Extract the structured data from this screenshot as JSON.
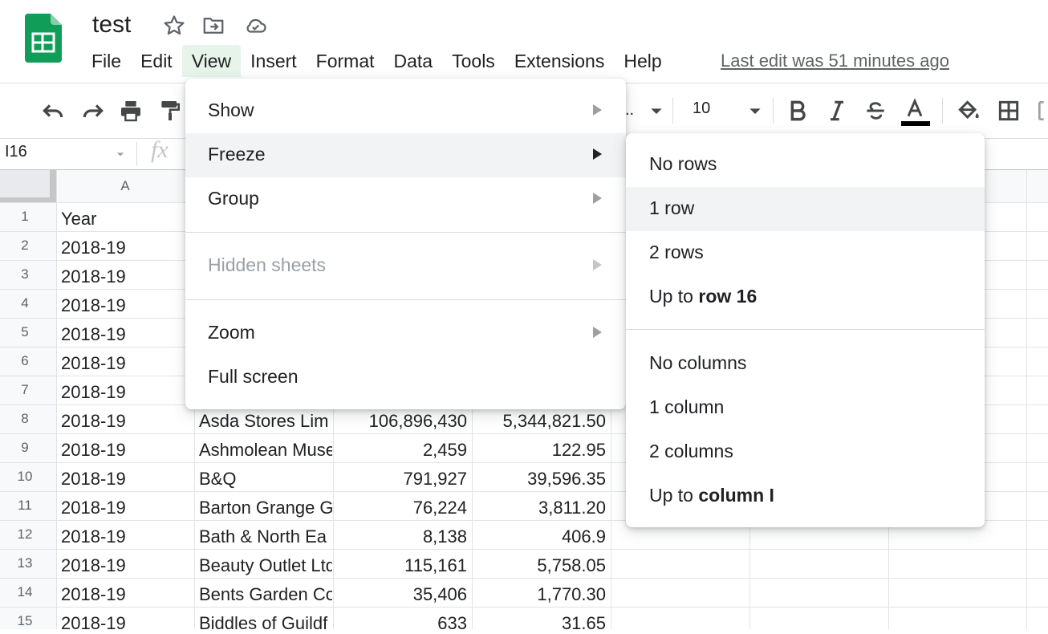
{
  "app": {
    "doc_title": "test",
    "last_edit": "Last edit was 51 minutes ago"
  },
  "menubar": {
    "items": [
      "File",
      "Edit",
      "View",
      "Insert",
      "Format",
      "Data",
      "Tools",
      "Extensions",
      "Help"
    ],
    "active": "View"
  },
  "toolbar": {
    "font_size": "10",
    "font_truncated": "..",
    "text_color": "#000000"
  },
  "formula_bar": {
    "name_box": "I16",
    "fx_label": "fx"
  },
  "grid": {
    "column_headers": [
      "A"
    ],
    "row_numbers": [
      "1",
      "2",
      "3",
      "4",
      "5",
      "6",
      "7",
      "8",
      "9",
      "10",
      "11",
      "12",
      "13",
      "14",
      "15"
    ],
    "column_a": [
      "Year",
      "2018-19",
      "2018-19",
      "2018-19",
      "2018-19",
      "2018-19",
      "2018-19",
      "2018-19",
      "2018-19",
      "2018-19",
      "2018-19",
      "2018-19",
      "2018-19",
      "2018-19",
      "2018-19"
    ],
    "visible_rows": [
      {
        "row": "8",
        "name": "Asda Stores Lim",
        "value1": "106,896,430",
        "value2": "5,344,821.50"
      },
      {
        "row": "9",
        "name": "Ashmolean Muse",
        "value1": "2,459",
        "value2": "122.95"
      },
      {
        "row": "10",
        "name": "B&Q",
        "value1": "791,927",
        "value2": "39,596.35"
      },
      {
        "row": "11",
        "name": "Barton Grange G",
        "value1": "76,224",
        "value2": "3,811.20"
      },
      {
        "row": "12",
        "name": "Bath & North Ea",
        "value1": "8,138",
        "value2": "406.9"
      },
      {
        "row": "13",
        "name": "Beauty Outlet Ltd",
        "value1": "115,161",
        "value2": "5,758.05"
      },
      {
        "row": "14",
        "name": "Bents Garden Co",
        "value1": "35,406",
        "value2": "1,770.30"
      },
      {
        "row": "15",
        "name": "Biddles of Guildf",
        "value1": "633",
        "value2": "31.65"
      }
    ]
  },
  "view_menu": {
    "items": [
      {
        "label": "Show",
        "has_submenu": true,
        "disabled": false
      },
      {
        "label": "Freeze",
        "has_submenu": true,
        "disabled": false,
        "highlighted": true
      },
      {
        "label": "Group",
        "has_submenu": true,
        "disabled": false
      },
      {
        "label": "Hidden sheets",
        "has_submenu": true,
        "disabled": true
      },
      {
        "label": "Zoom",
        "has_submenu": true,
        "disabled": false
      },
      {
        "label": "Full screen",
        "has_submenu": false,
        "disabled": false
      }
    ]
  },
  "freeze_menu": {
    "items": [
      {
        "label": "No rows"
      },
      {
        "label": "1 row",
        "highlighted": true
      },
      {
        "label": "2 rows"
      },
      {
        "label_prefix": "Up to ",
        "label_bold": "row 16"
      },
      {
        "label": "No columns"
      },
      {
        "label": "1 column"
      },
      {
        "label": "2 columns"
      },
      {
        "label_prefix": "Up to ",
        "label_bold": "column I"
      }
    ]
  },
  "colors": {
    "brand_green": "#0f9d58",
    "active_menu_bg": "#e6f4ea",
    "menu_highlight": "#f1f3f4"
  }
}
